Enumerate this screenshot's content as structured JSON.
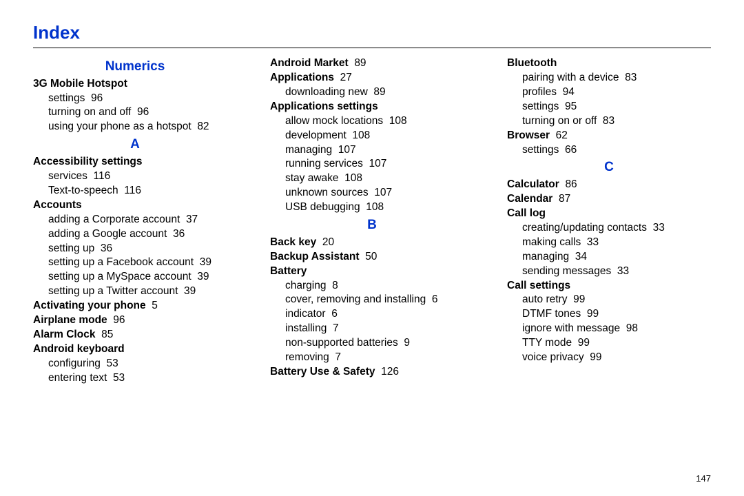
{
  "title": "Index",
  "page_number": "147",
  "columns": [
    {
      "sections": [
        {
          "letter": "Numerics",
          "groups": [
            {
              "heading": "3G Mobile Hotspot",
              "heading_page": "",
              "subs": [
                {
                  "text": "settings",
                  "page": "96"
                },
                {
                  "text": "turning on and off",
                  "page": "96"
                },
                {
                  "text": "using your phone as a hotspot",
                  "page": "82"
                }
              ]
            }
          ]
        },
        {
          "letter": "A",
          "groups": [
            {
              "heading": "Accessibility settings",
              "heading_page": "",
              "subs": [
                {
                  "text": "services",
                  "page": "116"
                },
                {
                  "text": "Text-to-speech",
                  "page": "116"
                }
              ]
            },
            {
              "heading": "Accounts",
              "heading_page": "",
              "subs": [
                {
                  "text": "adding a Corporate account",
                  "page": "37"
                },
                {
                  "text": "adding a Google account",
                  "page": "36"
                },
                {
                  "text": "setting up",
                  "page": "36"
                },
                {
                  "text": "setting up a Facebook account",
                  "page": "39"
                },
                {
                  "text": "setting up a MySpace account",
                  "page": "39"
                },
                {
                  "text": "setting up a Twitter account",
                  "page": "39"
                }
              ]
            },
            {
              "heading": "Activating your phone",
              "heading_page": "5",
              "subs": []
            },
            {
              "heading": "Airplane mode",
              "heading_page": "96",
              "subs": []
            },
            {
              "heading": "Alarm Clock",
              "heading_page": "85",
              "subs": []
            },
            {
              "heading": "Android keyboard",
              "heading_page": "",
              "subs": [
                {
                  "text": "configuring",
                  "page": "53"
                },
                {
                  "text": "entering text",
                  "page": "53"
                }
              ]
            }
          ]
        }
      ]
    },
    {
      "sections": [
        {
          "letter": "",
          "groups": [
            {
              "heading": "Android Market",
              "heading_page": "89",
              "subs": []
            },
            {
              "heading": "Applications",
              "heading_page": "27",
              "subs": [
                {
                  "text": "downloading new",
                  "page": "89"
                }
              ]
            },
            {
              "heading": "Applications settings",
              "heading_page": "",
              "subs": [
                {
                  "text": "allow mock locations",
                  "page": "108"
                },
                {
                  "text": "development",
                  "page": "108"
                },
                {
                  "text": "managing",
                  "page": "107"
                },
                {
                  "text": "running services",
                  "page": "107"
                },
                {
                  "text": "stay awake",
                  "page": "108"
                },
                {
                  "text": "unknown sources",
                  "page": "107"
                },
                {
                  "text": "USB debugging",
                  "page": "108"
                }
              ]
            }
          ]
        },
        {
          "letter": "B",
          "groups": [
            {
              "heading": "Back key",
              "heading_page": "20",
              "subs": []
            },
            {
              "heading": "Backup Assistant",
              "heading_page": "50",
              "subs": []
            },
            {
              "heading": "Battery",
              "heading_page": "",
              "subs": [
                {
                  "text": "charging",
                  "page": "8"
                },
                {
                  "text": "cover, removing and installing",
                  "page": "6"
                },
                {
                  "text": "indicator",
                  "page": "6"
                },
                {
                  "text": "installing",
                  "page": "7"
                },
                {
                  "text": "non-supported batteries",
                  "page": "9"
                },
                {
                  "text": "removing",
                  "page": "7"
                }
              ]
            },
            {
              "heading": "Battery Use & Safety",
              "heading_page": "126",
              "subs": []
            }
          ]
        }
      ]
    },
    {
      "sections": [
        {
          "letter": "",
          "groups": [
            {
              "heading": "Bluetooth",
              "heading_page": "",
              "subs": [
                {
                  "text": "pairing with a device",
                  "page": "83"
                },
                {
                  "text": "profiles",
                  "page": "94"
                },
                {
                  "text": "settings",
                  "page": "95"
                },
                {
                  "text": "turning on or off",
                  "page": "83"
                }
              ]
            },
            {
              "heading": "Browser",
              "heading_page": "62",
              "subs": [
                {
                  "text": "settings",
                  "page": "66"
                }
              ]
            }
          ]
        },
        {
          "letter": "C",
          "groups": [
            {
              "heading": "Calculator",
              "heading_page": "86",
              "subs": []
            },
            {
              "heading": "Calendar",
              "heading_page": "87",
              "subs": []
            },
            {
              "heading": "Call log",
              "heading_page": "",
              "subs": [
                {
                  "text": "creating/updating contacts",
                  "page": "33"
                },
                {
                  "text": "making calls",
                  "page": "33"
                },
                {
                  "text": "managing",
                  "page": "34"
                },
                {
                  "text": "sending messages",
                  "page": "33"
                }
              ]
            },
            {
              "heading": "Call settings",
              "heading_page": "",
              "subs": [
                {
                  "text": "auto retry",
                  "page": "99"
                },
                {
                  "text": "DTMF tones",
                  "page": "99"
                },
                {
                  "text": "ignore with message",
                  "page": "98"
                },
                {
                  "text": "TTY mode",
                  "page": "99"
                },
                {
                  "text": "voice privacy",
                  "page": "99"
                }
              ]
            }
          ]
        }
      ]
    }
  ]
}
